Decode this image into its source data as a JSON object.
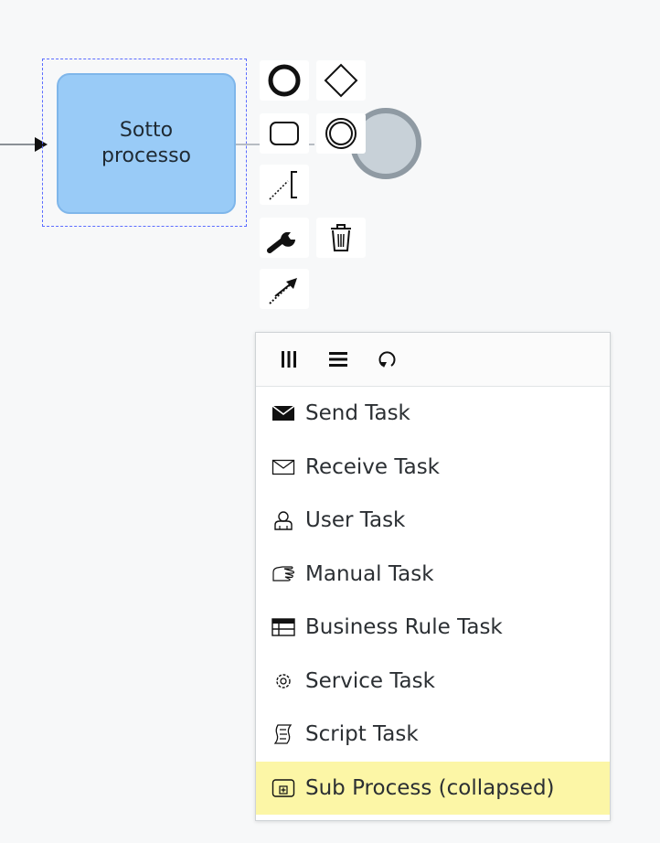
{
  "diagram": {
    "task_label": "Sotto processo"
  },
  "context_pad": {
    "items": [
      {
        "name": "end-event-icon"
      },
      {
        "name": "gateway-icon"
      },
      {
        "name": "task-icon"
      },
      {
        "name": "intermediate-event-icon"
      },
      {
        "name": "text-annotation-icon"
      },
      {
        "name": "wrench-icon"
      },
      {
        "name": "trash-icon"
      },
      {
        "name": "connect-arrow-icon"
      }
    ]
  },
  "replace_menu": {
    "header_icons": [
      "parallel-multi-instance-icon",
      "sequential-multi-instance-icon",
      "loop-icon"
    ],
    "items": [
      {
        "label": "Send Task",
        "icon": "send-envelope-icon"
      },
      {
        "label": "Receive Task",
        "icon": "receive-envelope-icon"
      },
      {
        "label": "User Task",
        "icon": "user-icon"
      },
      {
        "label": "Manual Task",
        "icon": "hand-icon"
      },
      {
        "label": "Business Rule Task",
        "icon": "table-icon"
      },
      {
        "label": "Service Task",
        "icon": "gear-icon"
      },
      {
        "label": "Script Task",
        "icon": "script-icon"
      },
      {
        "label": "Sub Process (collapsed)",
        "icon": "collapsed-subprocess-icon",
        "highlighted": true
      }
    ]
  },
  "colors": {
    "task_fill": "#99cbf7",
    "highlight": "#fcf6a6",
    "selection": "#5b6cff"
  }
}
